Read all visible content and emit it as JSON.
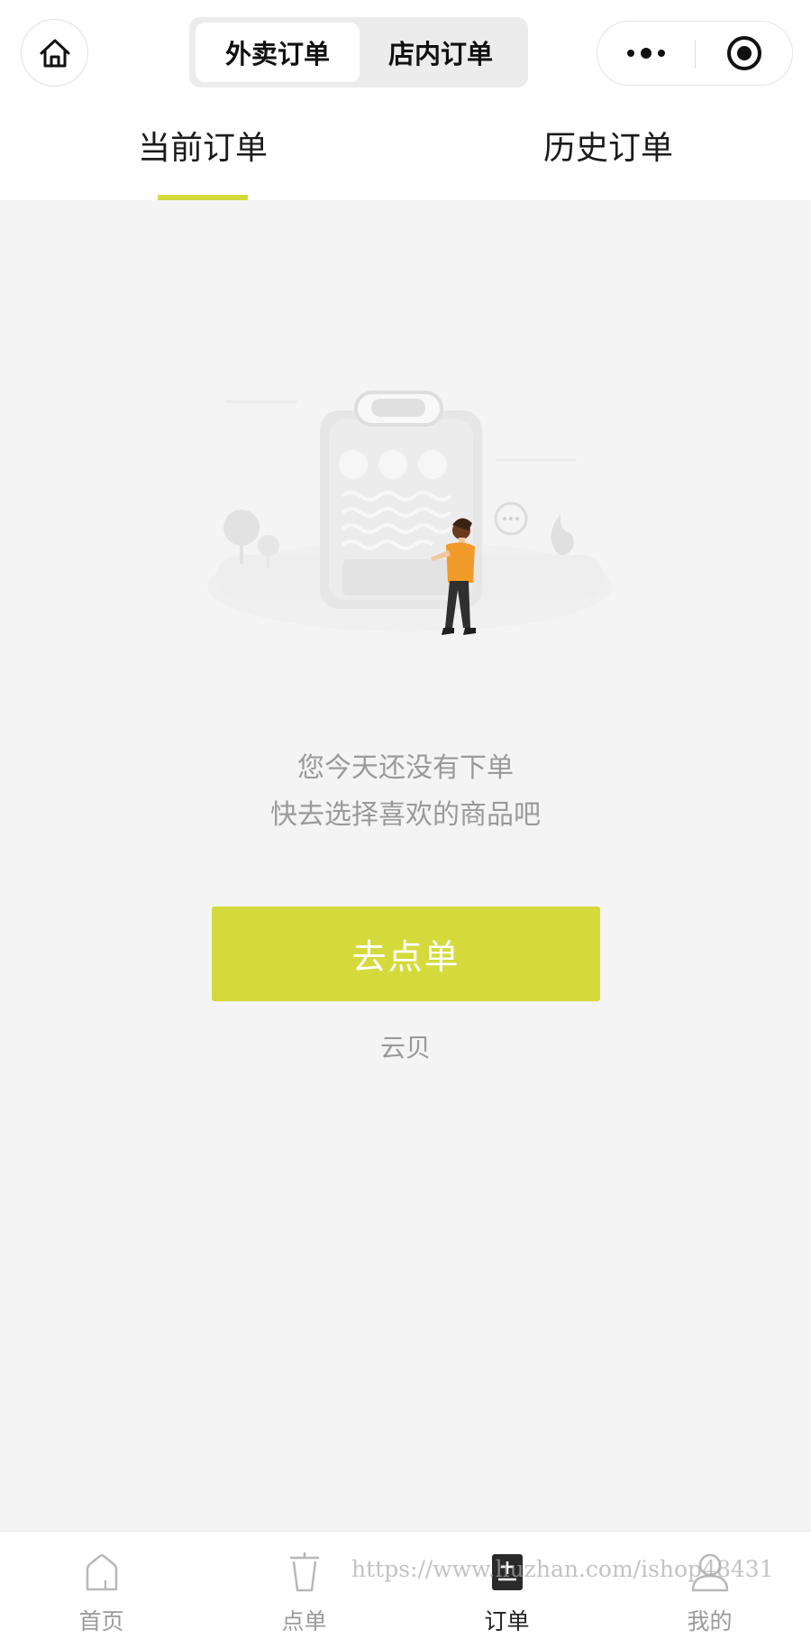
{
  "nav": {
    "segments": [
      "外卖订单",
      "店内订单"
    ],
    "active_segment": "外卖订单"
  },
  "order_tabs": {
    "current": "当前订单",
    "history": "历史订单",
    "active": "当前订单"
  },
  "empty_state": {
    "line1": "您今天还没有下单",
    "line2": "快去选择喜欢的商品吧",
    "button": "去点单",
    "brand": "云贝"
  },
  "tabbar": {
    "items": [
      {
        "label": "首页",
        "icon": "home-icon"
      },
      {
        "label": "点单",
        "icon": "cup-icon"
      },
      {
        "label": "订单",
        "icon": "order-icon"
      },
      {
        "label": "我的",
        "icon": "user-icon"
      }
    ],
    "active": "订单"
  },
  "watermark": "https://www.huzhan.com/ishop48431",
  "colors": {
    "accent": "#d5da3c",
    "background": "#f4f4f4",
    "muted_text": "#9a9a9a"
  }
}
